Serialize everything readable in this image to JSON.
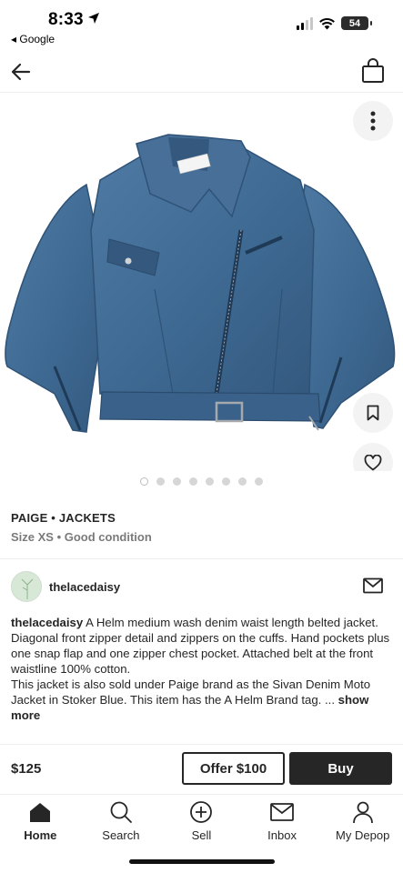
{
  "status_bar": {
    "time": "8:33",
    "back_label": "◂ Google",
    "battery": "54"
  },
  "icons": {
    "back": "arrow-left-icon",
    "bag": "shopping-bag-icon",
    "more": "more-vertical-icon",
    "save": "bookmark-icon",
    "like": "heart-icon",
    "mail": "mail-icon",
    "home": "home-icon",
    "search": "search-icon",
    "sell": "plus-circle-icon",
    "inbox": "inbox-icon",
    "profile": "person-icon"
  },
  "product": {
    "brand_line": "PAIGE • JACKETS",
    "size_line": "Size XS • Good condition",
    "image_count": 8,
    "active_image": 1
  },
  "seller": {
    "username": "thelacedaisy"
  },
  "description": {
    "username": "thelacedaisy",
    "text": " A Helm medium wash denim waist length belted jacket. Diagonal front zipper detail and zippers on the cuffs. Hand pockets plus one snap flap and one zipper chest pocket. Attached belt at the front waistline 100% cotton.",
    "text2": "This jacket is also sold under Paige brand as the Sivan Denim Moto Jacket in Stoker Blue. This item has the A Helm Brand tag. ... ",
    "show_more": "show more"
  },
  "purchase": {
    "price": "$125",
    "offer_label": "Offer $100",
    "buy_label": "Buy"
  },
  "tabbar": {
    "items": [
      {
        "label": "Home",
        "active": true
      },
      {
        "label": "Search",
        "active": false
      },
      {
        "label": "Sell",
        "active": false
      },
      {
        "label": "Inbox",
        "active": false
      },
      {
        "label": "My Depop",
        "active": false
      }
    ]
  },
  "colors": {
    "denim": "#3f6b94",
    "denim_dark": "#2f5277",
    "text": "#262626",
    "muted": "#7a7a7a"
  }
}
